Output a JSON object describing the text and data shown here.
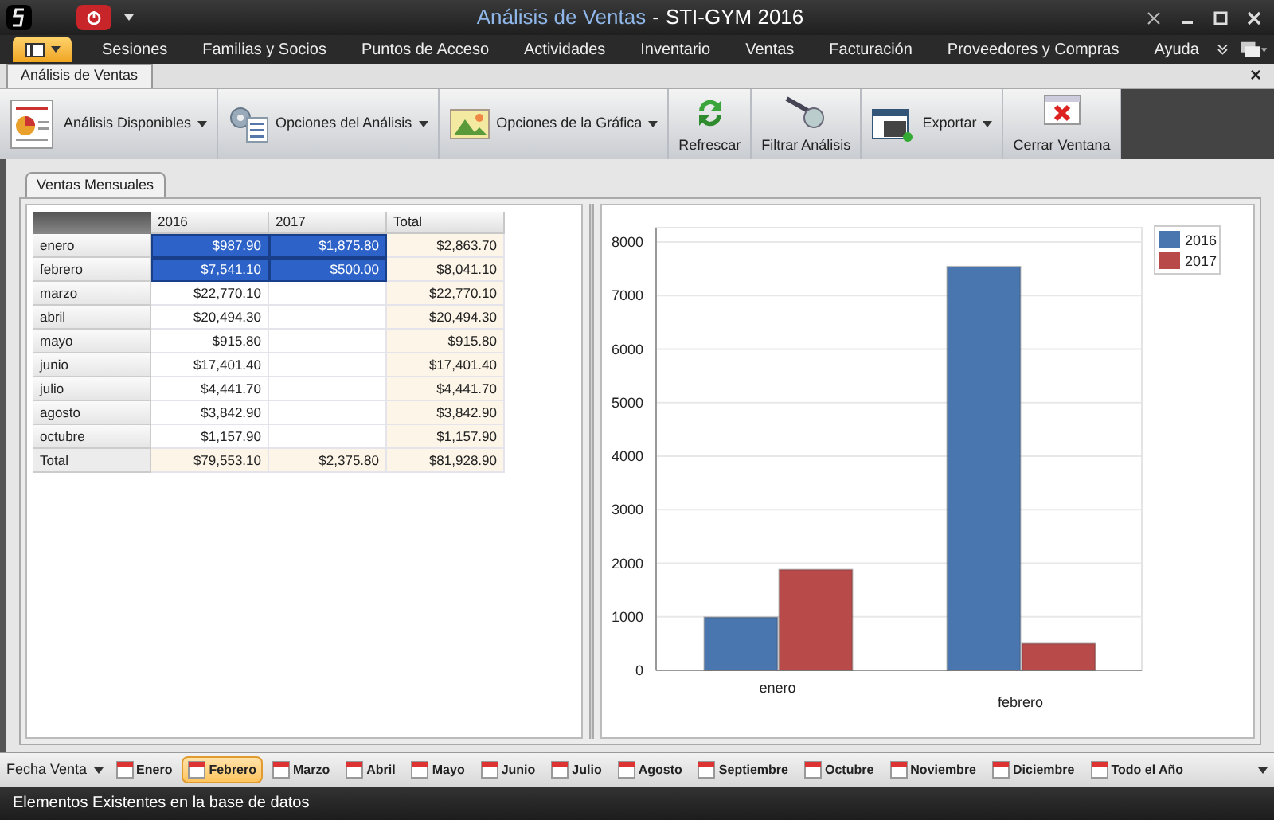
{
  "window": {
    "title_document": "Análisis de Ventas",
    "separator": "-",
    "title_app": "STI-GYM 2016"
  },
  "menu": [
    {
      "label": "Sesiones",
      "selected": false
    },
    {
      "label": "Familias y Socios",
      "selected": false
    },
    {
      "label": "Puntos de Acceso",
      "selected": false
    },
    {
      "label": "Actividades",
      "selected": false
    },
    {
      "label": "Inventario",
      "selected": false
    },
    {
      "label": "Ventas",
      "selected": false
    },
    {
      "label": "Facturación",
      "selected": false
    },
    {
      "label": "Proveedores y Compras",
      "selected": false
    },
    {
      "label": "Ayuda",
      "selected": false
    }
  ],
  "document_tab": {
    "label": "Análisis de Ventas",
    "close": "×"
  },
  "toolbar": [
    {
      "label": "Análisis Disponibles",
      "kind": "inline",
      "dropdown": true
    },
    {
      "label": "Opciones del Análisis",
      "kind": "inline",
      "dropdown": true
    },
    {
      "label": "Opciones de la Gráfica",
      "kind": "inline",
      "dropdown": true
    },
    {
      "label": "Refrescar",
      "kind": "stacked",
      "dropdown": false
    },
    {
      "label": "Filtrar Análisis",
      "kind": "stacked",
      "dropdown": false
    },
    {
      "label": "Exportar",
      "kind": "inline",
      "dropdown": true
    },
    {
      "label": "Cerrar Ventana",
      "kind": "stacked",
      "dropdown": false
    }
  ],
  "view_tab": {
    "label": "Ventas Mensuales",
    "selected": true
  },
  "table": {
    "columns": [
      "2016",
      "2017",
      "Total"
    ],
    "rows": [
      {
        "label": "enero",
        "kind": "month",
        "cells": [
          {
            "value": "$987.90",
            "selected": true
          },
          {
            "value": "$1,875.80",
            "selected": true
          },
          {
            "value": "$2,863.70",
            "selected": false
          }
        ]
      },
      {
        "label": "febrero",
        "kind": "month",
        "cells": [
          {
            "value": "$7,541.10",
            "selected": true
          },
          {
            "value": "$500.00",
            "selected": true
          },
          {
            "value": "$8,041.10",
            "selected": false
          }
        ]
      },
      {
        "label": "marzo",
        "kind": "month",
        "cells": [
          {
            "value": "$22,770.10",
            "selected": false
          },
          {
            "selected": false
          },
          {
            "value": "$22,770.10",
            "selected": false
          }
        ]
      },
      {
        "label": "abril",
        "kind": "month",
        "cells": [
          {
            "value": "$20,494.30",
            "selected": false
          },
          {
            "selected": false
          },
          {
            "value": "$20,494.30",
            "selected": false
          }
        ]
      },
      {
        "label": "mayo",
        "kind": "month",
        "cells": [
          {
            "value": "$915.80",
            "selected": false
          },
          {
            "selected": false
          },
          {
            "value": "$915.80",
            "selected": false
          }
        ]
      },
      {
        "label": "junio",
        "kind": "month",
        "cells": [
          {
            "value": "$17,401.40",
            "selected": false
          },
          {
            "selected": false
          },
          {
            "value": "$17,401.40",
            "selected": false
          }
        ]
      },
      {
        "label": "julio",
        "kind": "month",
        "cells": [
          {
            "value": "$4,441.70",
            "selected": false
          },
          {
            "selected": false
          },
          {
            "value": "$4,441.70",
            "selected": false
          }
        ]
      },
      {
        "label": "agosto",
        "kind": "month",
        "cells": [
          {
            "value": "$3,842.90",
            "selected": false
          },
          {
            "selected": false
          },
          {
            "value": "$3,842.90",
            "selected": false
          }
        ]
      },
      {
        "label": "octubre",
        "kind": "month",
        "cells": [
          {
            "value": "$1,157.90",
            "selected": false
          },
          {
            "selected": false
          },
          {
            "value": "$1,157.90",
            "selected": false
          }
        ]
      },
      {
        "label": "Total",
        "kind": "total",
        "cells": [
          {
            "value": "$79,553.10",
            "selected": false
          },
          {
            "value": "$2,375.80",
            "selected": false
          },
          {
            "value": "$81,928.90",
            "selected": false
          }
        ]
      }
    ]
  },
  "chart": {
    "chart_data": {
      "type": "bar",
      "categories": [
        "enero",
        "febrero"
      ],
      "series": [
        {
          "name": "2016",
          "color": "#4a76b0",
          "values": [
            990,
            7540
          ]
        },
        {
          "name": "2017",
          "color": "#b94a4a",
          "values": [
            1880,
            500
          ]
        }
      ],
      "grid": true,
      "legend": true,
      "ylim": [
        0,
        8000
      ],
      "yticks": [
        0,
        1000,
        2000,
        3000,
        4000,
        5000,
        6000,
        7000,
        8000
      ]
    }
  },
  "filter_bar": {
    "label": "Fecha Venta",
    "items": [
      {
        "label": "Enero",
        "selected": false
      },
      {
        "label": "Febrero",
        "selected": true
      },
      {
        "label": "Marzo",
        "selected": false
      },
      {
        "label": "Abril",
        "selected": false
      },
      {
        "label": "Mayo",
        "selected": false
      },
      {
        "label": "Junio",
        "selected": false
      },
      {
        "label": "Julio",
        "selected": false
      },
      {
        "label": "Agosto",
        "selected": false
      },
      {
        "label": "Septiembre",
        "selected": false
      },
      {
        "label": "Octubre",
        "selected": false
      },
      {
        "label": "Noviembre",
        "selected": false
      },
      {
        "label": "Diciembre",
        "selected": false
      },
      {
        "label": "Todo el Año",
        "selected": false
      }
    ]
  },
  "status_bar": "Elementos Existentes en la base de datos"
}
